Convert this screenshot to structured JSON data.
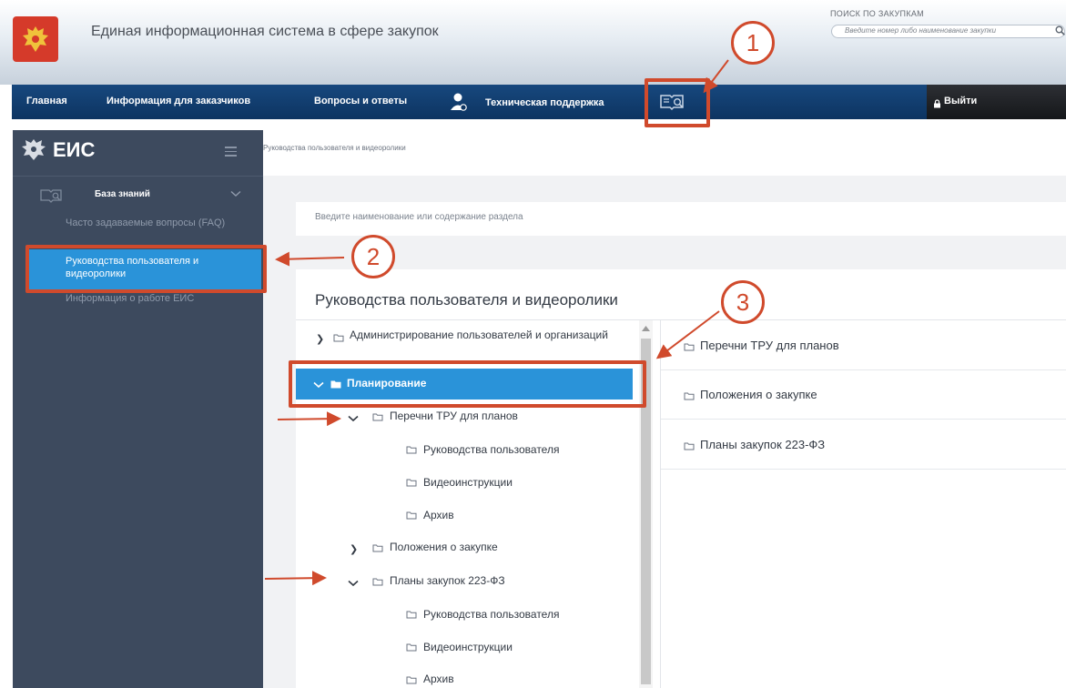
{
  "header": {
    "title": "Единая информационная система в сфере закупок",
    "search_caption": "ПОИСК ПО ЗАКУПКАМ",
    "search_placeholder": "Введите номер либо наименование закупки"
  },
  "nav": {
    "items": [
      {
        "label": "Главная"
      },
      {
        "label": "Информация для заказчиков"
      },
      {
        "label": "Вопросы и ответы"
      },
      {
        "label": "Техническая поддержка"
      }
    ],
    "logout_label": "Выйти"
  },
  "sidebar": {
    "brand": "ЕИС",
    "section_label": "База знаний",
    "links": [
      {
        "label": "Часто задаваемые вопросы (FAQ)"
      },
      {
        "label": "Руководства пользователя и видеоролики"
      },
      {
        "label": "Информация о работе ЕИС"
      }
    ]
  },
  "main": {
    "breadcrumb": "Руководства пользователя и видеоролики",
    "search_placeholder": "Введите наименование или содержание раздела",
    "panel_title": "Руководства пользователя и видеоролики",
    "tree": [
      {
        "label": "Администрирование пользователей и организаций",
        "expanded": false
      },
      {
        "label": "Планирование",
        "expanded": true,
        "selected": true
      },
      {
        "label": "Перечни ТРУ для планов",
        "expanded": true
      },
      {
        "label": "Руководства пользователя"
      },
      {
        "label": "Видеоинструкции"
      },
      {
        "label": "Архив"
      },
      {
        "label": "Положения о закупке",
        "expanded": false
      },
      {
        "label": "Планы закупок 223-ФЗ",
        "expanded": true
      },
      {
        "label": "Руководства пользователя"
      },
      {
        "label": "Видеоинструкции"
      },
      {
        "label": "Архив"
      }
    ],
    "right_list": [
      {
        "label": "Перечни ТРУ для планов"
      },
      {
        "label": "Положения о закупке"
      },
      {
        "label": "Планы закупок 223-ФЗ"
      }
    ]
  },
  "annotations": {
    "markers": [
      "1",
      "2",
      "3"
    ],
    "color": "#d04a2c"
  },
  "colors": {
    "nav_bar": "#0d3461",
    "sidebar": "#3d4a5e",
    "accent": "#2a93d9"
  }
}
